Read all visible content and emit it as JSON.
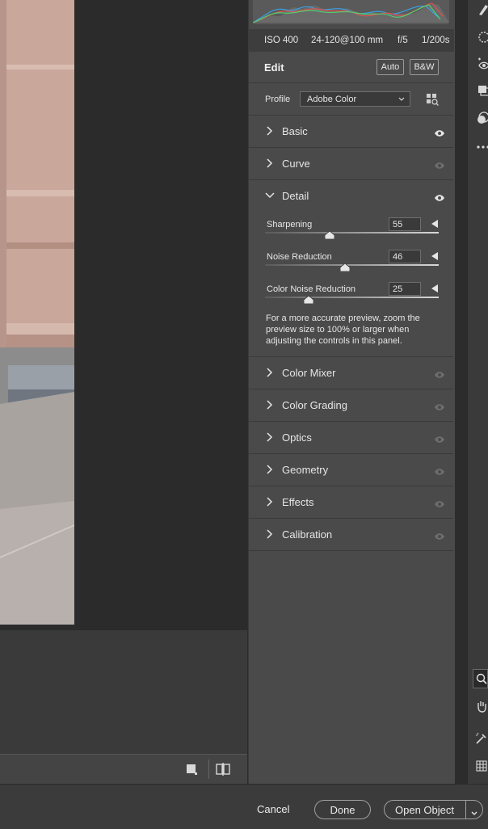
{
  "meta": {
    "iso": "ISO 400",
    "lens": "24-120@100 mm",
    "aperture": "f/5",
    "shutter": "1/200s"
  },
  "edit": {
    "title": "Edit",
    "auto_label": "Auto",
    "bw_label": "B&W",
    "profile_label": "Profile",
    "profile_value": "Adobe Color"
  },
  "sections": {
    "basic": "Basic",
    "curve": "Curve",
    "detail": "Detail",
    "color_mixer": "Color Mixer",
    "color_grading": "Color Grading",
    "optics": "Optics",
    "geometry": "Geometry",
    "effects": "Effects",
    "calibration": "Calibration"
  },
  "detail": {
    "sharpening_label": "Sharpening",
    "sharpening_value": "55",
    "sharpening_level": 0.37,
    "noise_label": "Noise Reduction",
    "noise_value": "46",
    "noise_level": 0.46,
    "color_noise_label": "Color Noise Reduction",
    "color_noise_value": "25",
    "color_noise_level": 0.25,
    "note": "For a more accurate preview, zoom the preview size to 100% or larger when adjusting the controls in this panel."
  },
  "footer": {
    "cancel": "Cancel",
    "done": "Done",
    "open_object": "Open Object"
  },
  "icons": {
    "histogram": "histogram-graph",
    "eye": "eye-icon",
    "chevron": "chevron-icon",
    "profile_browser": "grid-icon"
  }
}
